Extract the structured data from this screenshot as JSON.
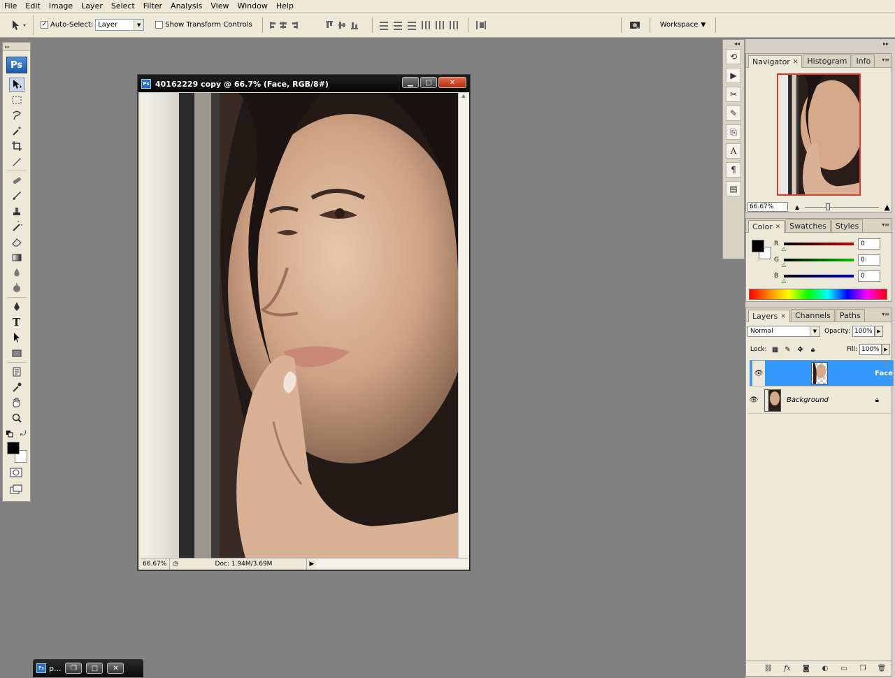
{
  "menu": [
    "File",
    "Edit",
    "Image",
    "Layer",
    "Select",
    "Filter",
    "Analysis",
    "View",
    "Window",
    "Help"
  ],
  "options": {
    "auto_select_label": "Auto-Select:",
    "auto_select_checked": "✓",
    "auto_select_value": "Layer",
    "show_transform_label": "Show Transform Controls",
    "workspace_label": "Workspace"
  },
  "toolbox": {
    "logo": "Ps",
    "tools": [
      "move-tool",
      "marquee-tool",
      "lasso-tool",
      "magic-wand-tool",
      "crop-tool",
      "slice-tool",
      "healing-brush-tool",
      "brush-tool",
      "clone-stamp-tool",
      "history-brush-tool",
      "eraser-tool",
      "gradient-tool",
      "blur-tool",
      "dodge-tool",
      "pen-tool",
      "type-tool",
      "path-selection-tool",
      "shape-tool",
      "notes-tool",
      "eyedropper-tool",
      "hand-tool",
      "zoom-tool"
    ]
  },
  "document": {
    "title": "40162229 copy @ 66.7% (Face, RGB/8#)",
    "zoom": "66.67%",
    "doc_info": "Doc: 1.94M/3.69M"
  },
  "navigator": {
    "tabs": [
      "Navigator",
      "Histogram",
      "Info"
    ],
    "zoom": "66.67%"
  },
  "color": {
    "tabs": [
      "Color",
      "Swatches",
      "Styles"
    ],
    "r_label": "R",
    "g_label": "G",
    "b_label": "B",
    "r": "0",
    "g": "0",
    "b": "0",
    "r_color": "#d40000",
    "g_color": "#00c000",
    "b_color": "#0000d0"
  },
  "layers": {
    "tabs": [
      "Layers",
      "Channels",
      "Paths"
    ],
    "blend_mode": "Normal",
    "opacity_label": "Opacity:",
    "opacity": "100%",
    "lock_label": "Lock:",
    "fill_label": "Fill:",
    "fill": "100%",
    "items": [
      {
        "name": "Face",
        "selected": true
      },
      {
        "name": "Background",
        "locked": true
      }
    ]
  },
  "minimized": {
    "label": "p..."
  }
}
